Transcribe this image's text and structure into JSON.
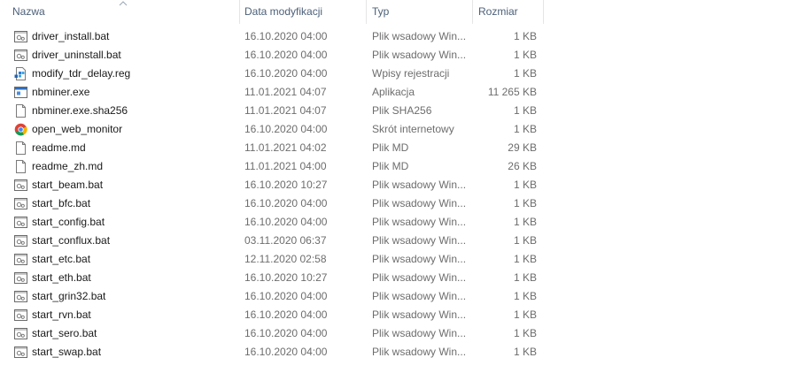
{
  "columns": {
    "name": "Nazwa",
    "date": "Data modyfikacji",
    "type": "Typ",
    "size": "Rozmiar"
  },
  "files": [
    {
      "name": "driver_install.bat",
      "date": "16.10.2020 04:00",
      "type": "Plik wsadowy Win...",
      "size": "1 KB",
      "icon": "batch-file-icon"
    },
    {
      "name": "driver_uninstall.bat",
      "date": "16.10.2020 04:00",
      "type": "Plik wsadowy Win...",
      "size": "1 KB",
      "icon": "batch-file-icon"
    },
    {
      "name": "modify_tdr_delay.reg",
      "date": "16.10.2020 04:00",
      "type": "Wpisy rejestracji",
      "size": "1 KB",
      "icon": "registry-file-icon"
    },
    {
      "name": "nbminer.exe",
      "date": "11.01.2021 04:07",
      "type": "Aplikacja",
      "size": "11 265 KB",
      "icon": "application-icon"
    },
    {
      "name": "nbminer.exe.sha256",
      "date": "11.01.2021 04:07",
      "type": "Plik SHA256",
      "size": "1 KB",
      "icon": "blank-file-icon"
    },
    {
      "name": "open_web_monitor",
      "date": "16.10.2020 04:00",
      "type": "Skrót internetowy",
      "size": "1 KB",
      "icon": "chrome-shortcut-icon"
    },
    {
      "name": "readme.md",
      "date": "11.01.2021 04:02",
      "type": "Plik MD",
      "size": "29 KB",
      "icon": "blank-file-icon"
    },
    {
      "name": "readme_zh.md",
      "date": "11.01.2021 04:00",
      "type": "Plik MD",
      "size": "26 KB",
      "icon": "blank-file-icon"
    },
    {
      "name": "start_beam.bat",
      "date": "16.10.2020 10:27",
      "type": "Plik wsadowy Win...",
      "size": "1 KB",
      "icon": "batch-file-icon"
    },
    {
      "name": "start_bfc.bat",
      "date": "16.10.2020 04:00",
      "type": "Plik wsadowy Win...",
      "size": "1 KB",
      "icon": "batch-file-icon"
    },
    {
      "name": "start_config.bat",
      "date": "16.10.2020 04:00",
      "type": "Plik wsadowy Win...",
      "size": "1 KB",
      "icon": "batch-file-icon"
    },
    {
      "name": "start_conflux.bat",
      "date": "03.11.2020 06:37",
      "type": "Plik wsadowy Win...",
      "size": "1 KB",
      "icon": "batch-file-icon"
    },
    {
      "name": "start_etc.bat",
      "date": "12.11.2020 02:58",
      "type": "Plik wsadowy Win...",
      "size": "1 KB",
      "icon": "batch-file-icon"
    },
    {
      "name": "start_eth.bat",
      "date": "16.10.2020 10:27",
      "type": "Plik wsadowy Win...",
      "size": "1 KB",
      "icon": "batch-file-icon"
    },
    {
      "name": "start_grin32.bat",
      "date": "16.10.2020 04:00",
      "type": "Plik wsadowy Win...",
      "size": "1 KB",
      "icon": "batch-file-icon"
    },
    {
      "name": "start_rvn.bat",
      "date": "16.10.2020 04:00",
      "type": "Plik wsadowy Win...",
      "size": "1 KB",
      "icon": "batch-file-icon"
    },
    {
      "name": "start_sero.bat",
      "date": "16.10.2020 04:00",
      "type": "Plik wsadowy Win...",
      "size": "1 KB",
      "icon": "batch-file-icon"
    },
    {
      "name": "start_swap.bat",
      "date": "16.10.2020 04:00",
      "type": "Plik wsadowy Win...",
      "size": "1 KB",
      "icon": "batch-file-icon"
    }
  ]
}
